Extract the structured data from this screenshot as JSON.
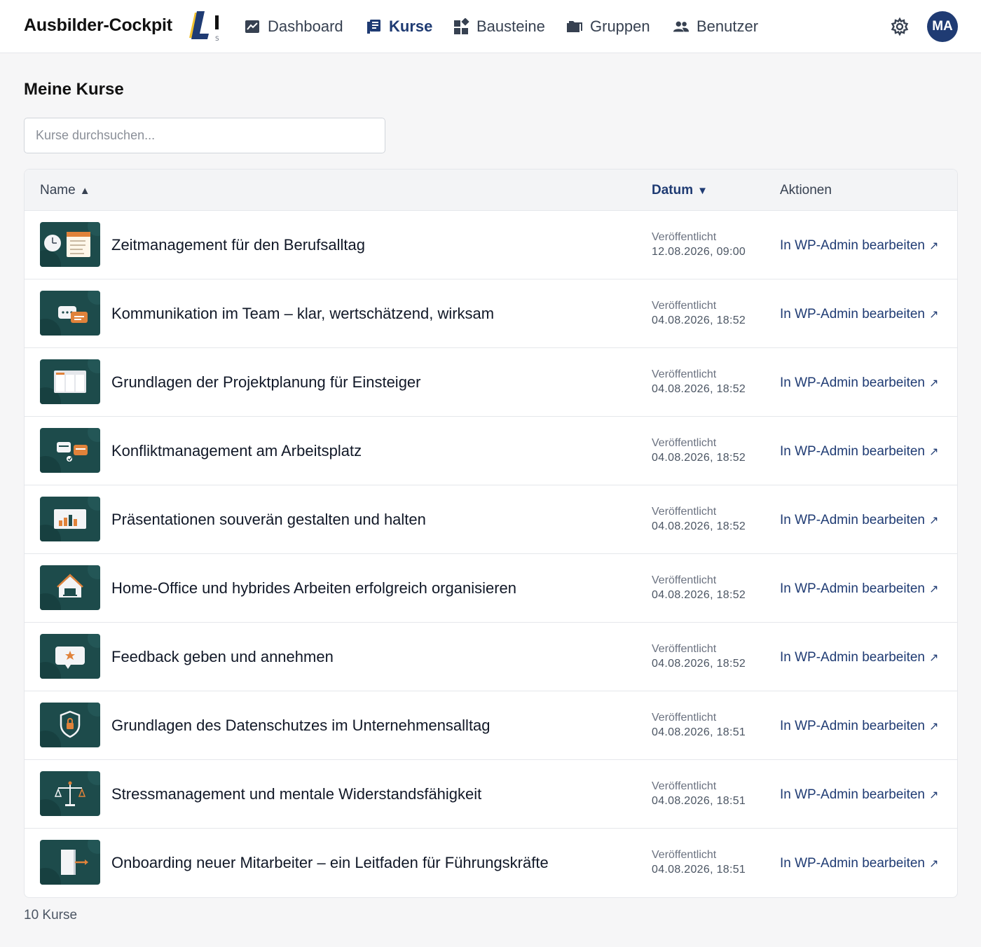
{
  "app": {
    "title": "Ausbilder-Cockpit",
    "logo_icon": "ls-logo"
  },
  "nav": [
    {
      "label": "Dashboard",
      "icon": "chart-icon",
      "active": false
    },
    {
      "label": "Kurse",
      "icon": "book-icon",
      "active": true
    },
    {
      "label": "Bausteine",
      "icon": "blocks-icon",
      "active": false
    },
    {
      "label": "Gruppen",
      "icon": "folder-icon",
      "active": false
    },
    {
      "label": "Benutzer",
      "icon": "users-icon",
      "active": false
    }
  ],
  "user": {
    "initials": "MA",
    "color": "#1f3b73"
  },
  "page": {
    "title": "Meine Kurse",
    "search_placeholder": "Kurse durchsuchen..."
  },
  "table": {
    "headers": {
      "name": "Name",
      "name_sort": "▲",
      "date": "Datum",
      "date_sort": "▼",
      "actions": "Aktionen"
    },
    "rows": [
      {
        "title": "Zeitmanagement für den Berufsalltag",
        "status": "Veröffentlicht",
        "date": "12.08.2026, 09:00",
        "action": "In WP-Admin bearbeiten",
        "icon": "calendar-clock"
      },
      {
        "title": "Kommunikation im Team – klar, wertschätzend, wirksam",
        "status": "Veröffentlicht",
        "date": "04.08.2026, 18:52",
        "action": "In WP-Admin bearbeiten",
        "icon": "chat-bubbles"
      },
      {
        "title": "Grundlagen der Projektplanung für Einsteiger",
        "status": "Veröffentlicht",
        "date": "04.08.2026, 18:52",
        "action": "In WP-Admin bearbeiten",
        "icon": "kanban-board"
      },
      {
        "title": "Konfliktmanagement am Arbeitsplatz",
        "status": "Veröffentlicht",
        "date": "04.08.2026, 18:52",
        "action": "In WP-Admin bearbeiten",
        "icon": "conflict-chat"
      },
      {
        "title": "Präsentationen souverän gestalten und halten",
        "status": "Veröffentlicht",
        "date": "04.08.2026, 18:52",
        "action": "In WP-Admin bearbeiten",
        "icon": "presentation-chart"
      },
      {
        "title": "Home-Office und hybrides Arbeiten erfolgreich organisieren",
        "status": "Veröffentlicht",
        "date": "04.08.2026, 18:52",
        "action": "In WP-Admin bearbeiten",
        "icon": "home-laptop"
      },
      {
        "title": "Feedback geben und annehmen",
        "status": "Veröffentlicht",
        "date": "04.08.2026, 18:52",
        "action": "In WP-Admin bearbeiten",
        "icon": "feedback-star"
      },
      {
        "title": "Grundlagen des Datenschutzes im Unternehmensalltag",
        "status": "Veröffentlicht",
        "date": "04.08.2026, 18:51",
        "action": "In WP-Admin bearbeiten",
        "icon": "shield-lock"
      },
      {
        "title": "Stressmanagement und mentale Widerstandsfähigkeit",
        "status": "Veröffentlicht",
        "date": "04.08.2026, 18:51",
        "action": "In WP-Admin bearbeiten",
        "icon": "balance-scale"
      },
      {
        "title": "Onboarding neuer Mitarbeiter – ein Leitfaden für Führungskräfte",
        "status": "Veröffentlicht",
        "date": "04.08.2026, 18:51",
        "action": "In WP-Admin bearbeiten",
        "icon": "door-arrow"
      }
    ]
  },
  "footer": {
    "count": "10 Kurse"
  },
  "colors": {
    "accent": "#1f3b73",
    "thumb_bg": "#1d4b4b",
    "thumb_orange": "#e0823a",
    "logo_yellow": "#f2c12e"
  }
}
